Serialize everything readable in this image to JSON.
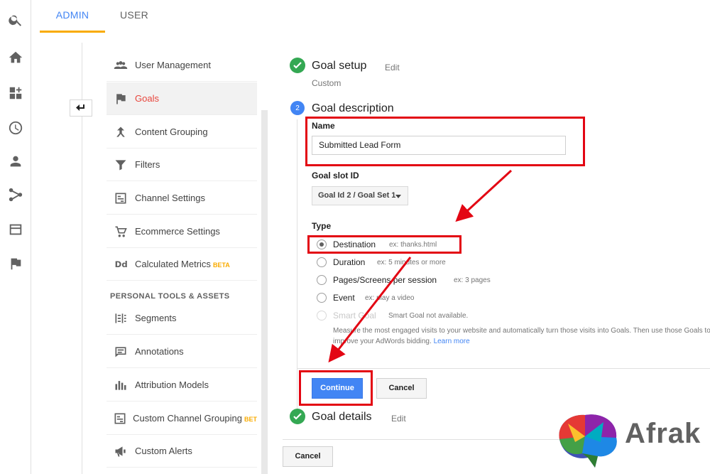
{
  "tabs": {
    "admin": "ADMIN",
    "user": "USER"
  },
  "rail_icons": [
    "search-icon",
    "home-icon",
    "customization-icon",
    "realtime-icon",
    "audience-icon",
    "acquisition-icon",
    "behavior-icon",
    "conversions-icon"
  ],
  "nav": {
    "items": [
      {
        "label": "User Management",
        "icon": "users-icon"
      },
      {
        "label": "Goals",
        "icon": "flag-icon",
        "active": true
      },
      {
        "label": "Content Grouping",
        "icon": "grouping-icon"
      },
      {
        "label": "Filters",
        "icon": "filter-icon"
      },
      {
        "label": "Channel Settings",
        "icon": "channel-icon"
      },
      {
        "label": "Ecommerce Settings",
        "icon": "cart-icon"
      },
      {
        "label": "Calculated Metrics",
        "badge": "BETA",
        "icon": "dd-icon"
      }
    ],
    "section_header": "PERSONAL TOOLS & ASSETS",
    "tools": [
      {
        "label": "Segments",
        "icon": "segments-icon"
      },
      {
        "label": "Annotations",
        "icon": "annotation-icon"
      },
      {
        "label": "Attribution Models",
        "icon": "attribution-icon"
      },
      {
        "label": "Custom Channel Grouping",
        "badge": "BET",
        "icon": "channel-icon"
      },
      {
        "label": "Custom Alerts",
        "icon": "megaphone-icon"
      }
    ]
  },
  "goal_setup": {
    "title": "Goal setup",
    "edit": "Edit",
    "sub": "Custom"
  },
  "goal_description": {
    "step": "2",
    "title": "Goal description",
    "name_label": "Name",
    "name_value": "Submitted Lead Form",
    "slot_label": "Goal slot ID",
    "slot_value": "Goal Id 2 / Goal Set 1",
    "type_label": "Type",
    "types": [
      {
        "label": "Destination",
        "example": "ex: thanks.html",
        "checked": true
      },
      {
        "label": "Duration",
        "example": "ex: 5 minutes or more"
      },
      {
        "label": "Pages/Screens per session",
        "example": "ex: 3 pages"
      },
      {
        "label": "Event",
        "example": "ex: play a video"
      },
      {
        "label": "Smart Goal",
        "example": "Smart Goal not available.",
        "disabled": true
      }
    ],
    "smart_line1": "Measure the most engaged visits to your website and automatically turn those visits into Goals. Then use those Goals to",
    "smart_line2": "improve your AdWords bidding.",
    "learn_more": "Learn more",
    "continue": "Continue",
    "cancel": "Cancel"
  },
  "goal_details": {
    "title": "Goal details",
    "edit": "Edit"
  },
  "bottom_cancel": "Cancel",
  "logo_text": "Afrak",
  "colors": {
    "accent": "#4285f4",
    "annotation": "#e30613",
    "success": "#34a853",
    "tab_underline": "#f9ab00"
  }
}
